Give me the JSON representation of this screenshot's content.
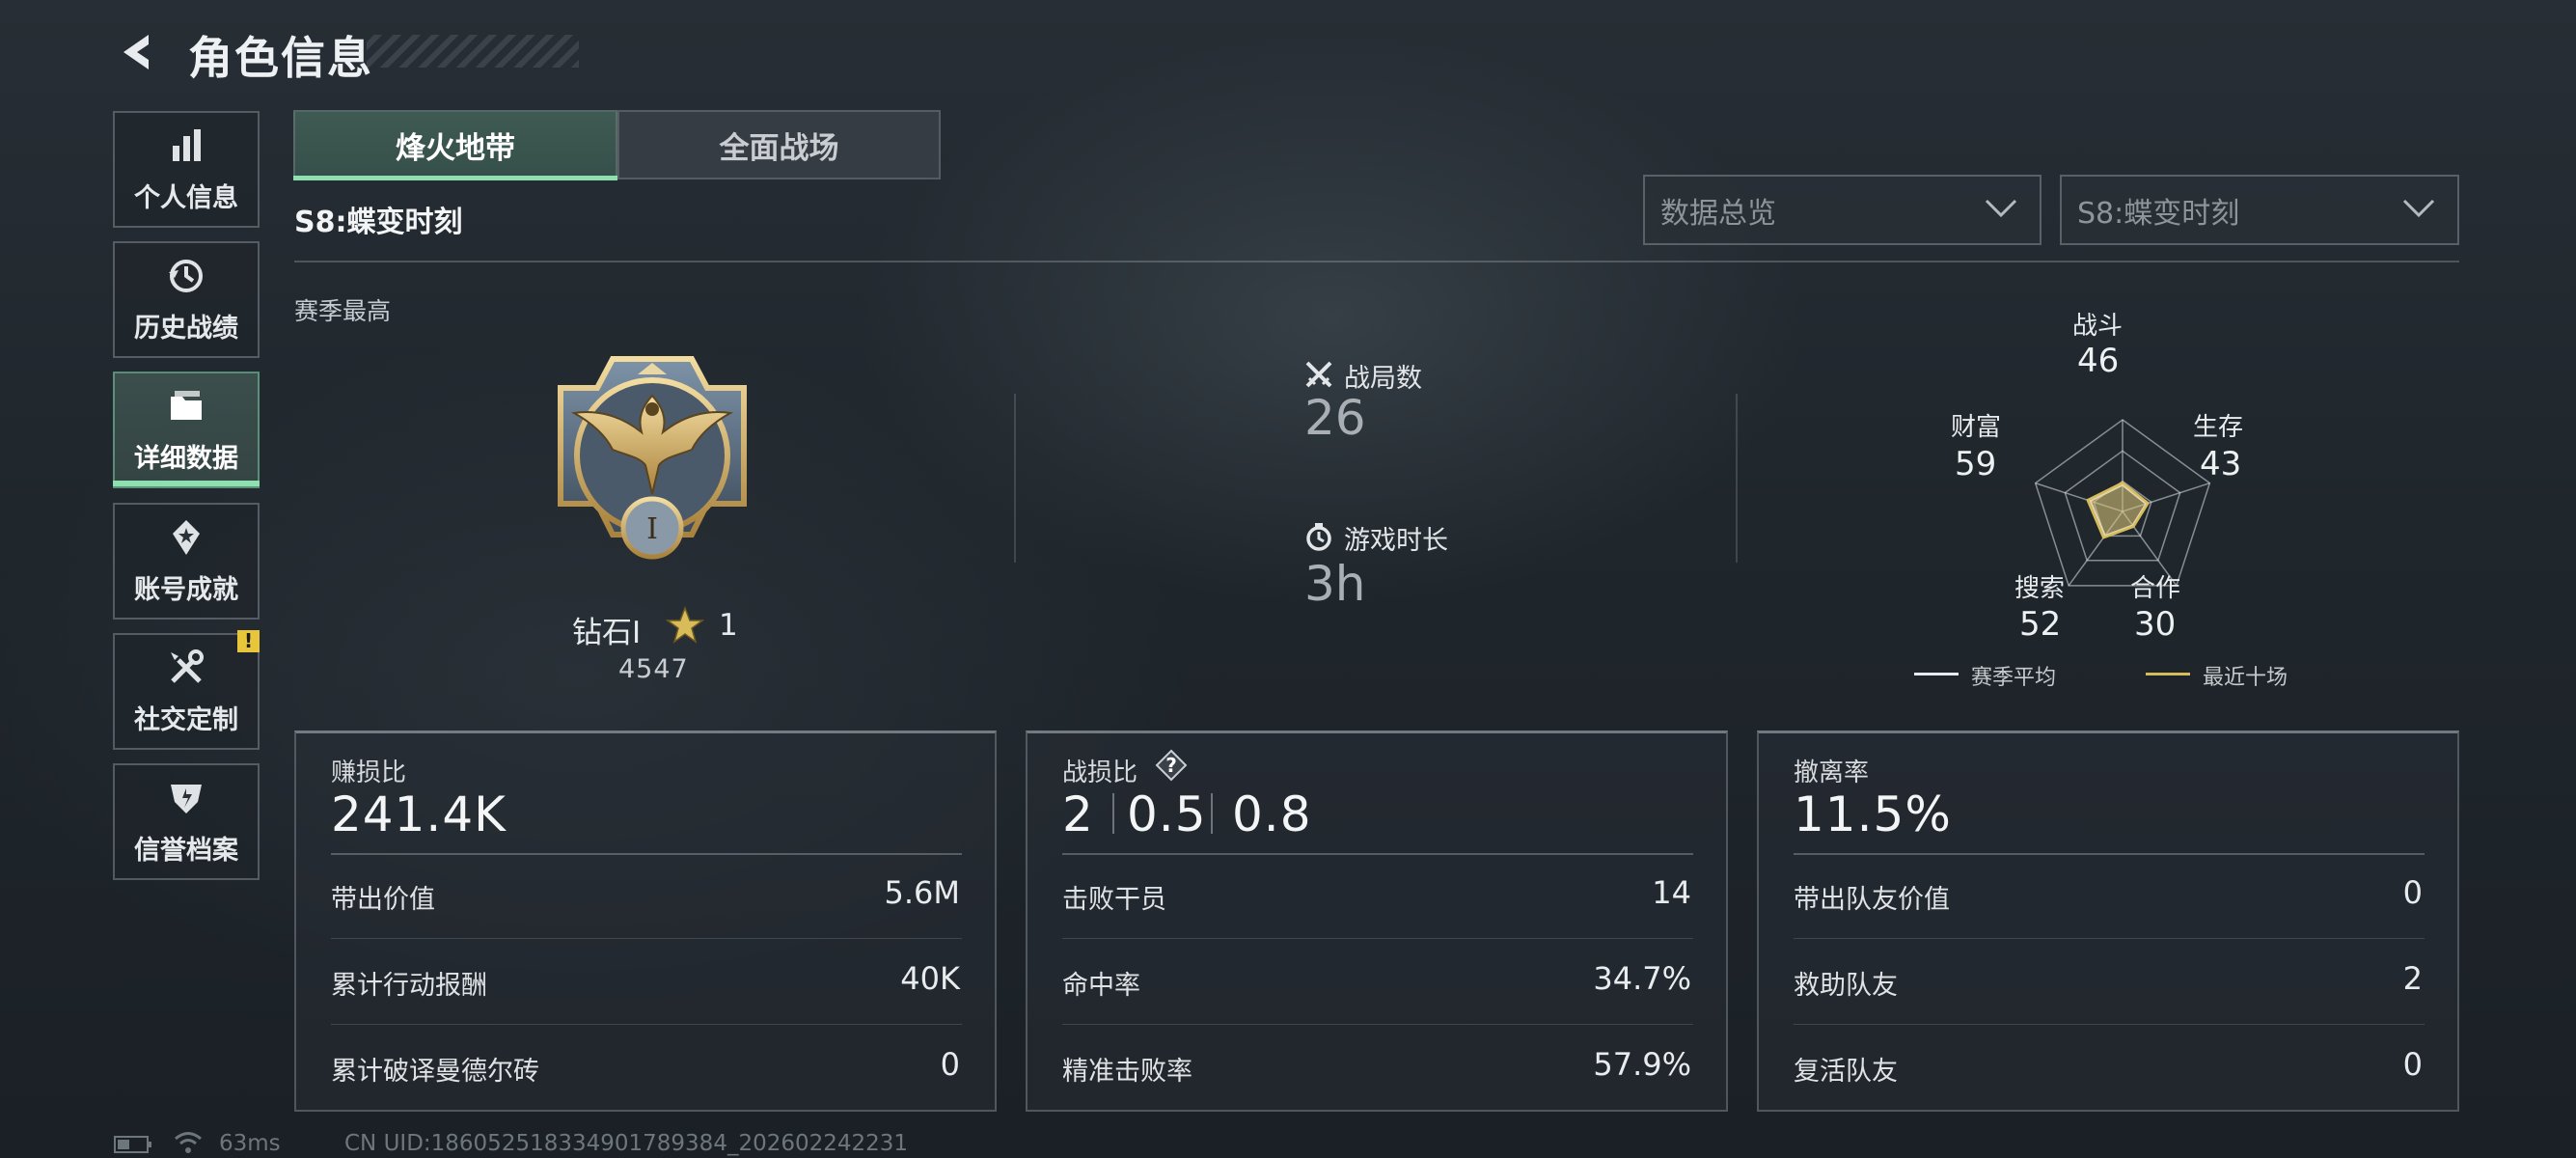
{
  "header": {
    "title": "角色信息"
  },
  "sidebar": {
    "items": [
      {
        "label": "个人信息",
        "icon": "bar-chart-icon"
      },
      {
        "label": "历史战绩",
        "icon": "history-icon"
      },
      {
        "label": "详细数据",
        "icon": "folder-icon",
        "active": true
      },
      {
        "label": "账号成就",
        "icon": "achievement-icon"
      },
      {
        "label": "社交定制",
        "icon": "tools-icon",
        "badge": "!"
      },
      {
        "label": "信誉档案",
        "icon": "credit-shield-icon"
      }
    ]
  },
  "tabs": [
    {
      "label": "烽火地带",
      "active": true
    },
    {
      "label": "全面战场"
    }
  ],
  "season_name": "S8:蝶变时刻",
  "filters": {
    "category": "数据总览",
    "season": "S8:蝶变时刻"
  },
  "season_best_label": "赛季最高",
  "rank": {
    "name": "钻石Ⅰ",
    "stars": "1",
    "score": "4547"
  },
  "summary": {
    "matches": {
      "label": "战局数",
      "value": "26",
      "icon": "crossed-swords-icon"
    },
    "playtime": {
      "label": "游戏时长",
      "value": "3h",
      "icon": "stopwatch-icon"
    }
  },
  "radar": {
    "axes": [
      {
        "label": "战斗",
        "value": "46"
      },
      {
        "label": "生存",
        "value": "43"
      },
      {
        "label": "合作",
        "value": "30"
      },
      {
        "label": "搜索",
        "value": "52"
      },
      {
        "label": "财富",
        "value": "59"
      }
    ],
    "legend": [
      {
        "label": "赛季平均",
        "color": "#e8ecef"
      },
      {
        "label": "最近十场",
        "color": "#d9bc5a"
      }
    ]
  },
  "cards": [
    {
      "title": "赚损比",
      "value": "241.4K",
      "rows": [
        {
          "label": "带出价值",
          "value": "5.6M"
        },
        {
          "label": "累计行动报酬",
          "value": "40K"
        },
        {
          "label": "累计破译曼德尔砖",
          "value": "0"
        }
      ]
    },
    {
      "title": "战损比",
      "values": [
        "2",
        "0.5",
        "0.8"
      ],
      "help": "?",
      "rows": [
        {
          "label": "击败干员",
          "value": "14"
        },
        {
          "label": "命中率",
          "value": "34.7%"
        },
        {
          "label": "精准击败率",
          "value": "57.9%"
        }
      ]
    },
    {
      "title": "撤离率",
      "value": "11.5%",
      "rows": [
        {
          "label": "带出队友价值",
          "value": "0"
        },
        {
          "label": "救助队友",
          "value": "2"
        },
        {
          "label": "复活队友",
          "value": "0"
        }
      ]
    }
  ],
  "footer": {
    "ping": "63ms",
    "uid": "CN UID:186052518334901789384_202602242231"
  },
  "colors": {
    "accent": "#8fe0b0",
    "badge": "#e8c63c",
    "recent_line": "#d9bc5a"
  }
}
